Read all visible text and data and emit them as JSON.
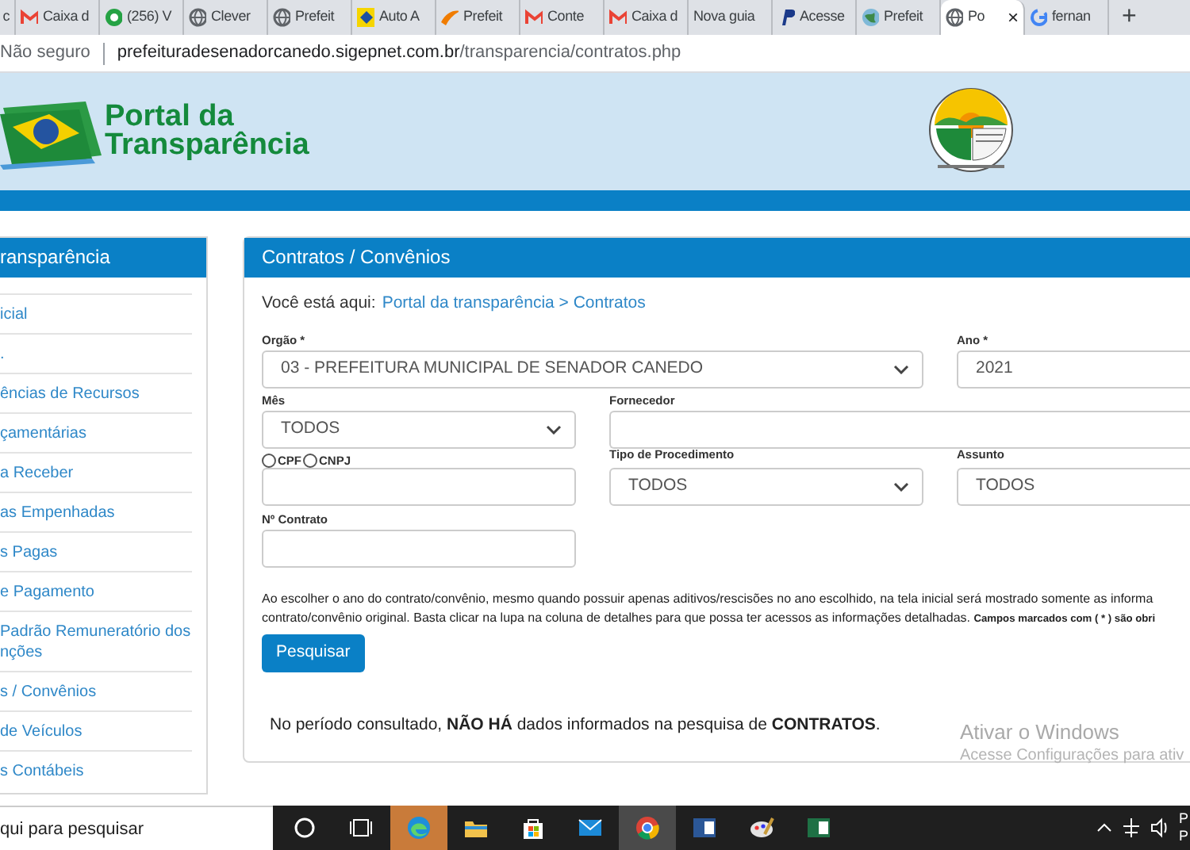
{
  "browser": {
    "tabs": [
      {
        "label": "c",
        "kind": "plain",
        "selected": false
      },
      {
        "label": "Caixa d",
        "kind": "mail",
        "selected": false
      },
      {
        "label": "(256) V",
        "kind": "chat",
        "selected": false
      },
      {
        "label": "Clever",
        "kind": "globe",
        "selected": false
      },
      {
        "label": "Prefeit",
        "kind": "globe",
        "selected": false
      },
      {
        "label": "Auto A",
        "kind": "bank",
        "selected": false
      },
      {
        "label": "Prefeit",
        "kind": "swoosh",
        "selected": false
      },
      {
        "label": "Conte",
        "kind": "mail",
        "selected": false
      },
      {
        "label": "Caixa d",
        "kind": "mail",
        "selected": false
      },
      {
        "label": "Nova guia",
        "kind": "plain",
        "selected": false
      },
      {
        "label": "Acesse",
        "kind": "pay",
        "selected": false
      },
      {
        "label": "Prefeit",
        "kind": "earth",
        "selected": false
      },
      {
        "label": "Po",
        "kind": "globe",
        "selected": true
      },
      {
        "label": "fernan",
        "kind": "google",
        "selected": false
      }
    ],
    "new_tab": "+",
    "close": "×",
    "security": "Não seguro",
    "url_host": "prefeituradesenadorcanedo.sigepnet.com.br",
    "url_path": "/transparencia/contratos.php"
  },
  "header": {
    "logo_line1": "Portal da",
    "logo_line2": "Transparência"
  },
  "sidebar": {
    "title": "ransparência",
    "items": [
      {
        "label": "icial"
      },
      {
        "label": "."
      },
      {
        "label": "ências de Recursos"
      },
      {
        "label": "çamentárias"
      },
      {
        "label": "a Receber"
      },
      {
        "label": "as Empenhadas"
      },
      {
        "label": "s Pagas"
      },
      {
        "label": "e Pagamento"
      },
      {
        "label": "Padrão Remuneratório dos nções"
      },
      {
        "label": "s / Convênios"
      },
      {
        "label": "de Veículos"
      },
      {
        "label": "s Contábeis"
      }
    ]
  },
  "main": {
    "title": "Contratos / Convênios",
    "breadcrumb_prefix": "Você está aqui:",
    "breadcrumb": "Portal da transparência > Contratos",
    "orgao": {
      "label": "Orgão *",
      "value": "03 - PREFEITURA MUNICIPAL DE SENADOR CANEDO"
    },
    "ano": {
      "label": "Ano *",
      "value": "2021"
    },
    "mes": {
      "label": "Mês",
      "value": "TODOS"
    },
    "fornecedor": {
      "label": "Fornecedor"
    },
    "documento": {
      "options": [
        {
          "label": "CPF",
          "selected": false
        },
        {
          "label": "CNPJ",
          "selected": false
        }
      ]
    },
    "tipo_procedimento": {
      "label": "Tipo de Procedimento",
      "value": "TODOS"
    },
    "assunto": {
      "label": "Assunto",
      "value": "TODOS"
    },
    "numero_contrato": {
      "label": "Nº Contrato"
    },
    "note_lines": [
      "Ao escolher o ano do contrato/convênio, mesmo quando possuir apenas aditivos/rescisões no ano escolhido, na tela inicial será mostrado somente as informa",
      "contrato/convênio original. Basta clicar na lupa na coluna de detalhes para que possa ter acessos as informações detalhadas. **Campos marcados com ( * ) são obri**"
    ],
    "search_button": "Pesquisar",
    "result": "No período consultado, **NÃO HÁ** dados informados na pesquisa de **CONTRATOS**."
  },
  "os_watermark": {
    "line1": "Ativar o Windows",
    "line2": "Acesse Configurações para ativ"
  },
  "taskbar": {
    "search_placeholder": "qui para pesquisar",
    "apps": [
      {
        "kind": "circle",
        "active": false
      },
      {
        "kind": "taskview",
        "active": false
      },
      {
        "kind": "edge",
        "active": true
      },
      {
        "kind": "folder",
        "active": false
      },
      {
        "kind": "store",
        "active": false
      },
      {
        "kind": "mail",
        "active": false
      },
      {
        "kind": "chrome",
        "active": true
      },
      {
        "kind": "word",
        "active": false
      },
      {
        "kind": "paint",
        "active": false
      },
      {
        "kind": "excel",
        "active": false
      }
    ],
    "clock_lines": [
      "P",
      "P"
    ]
  }
}
